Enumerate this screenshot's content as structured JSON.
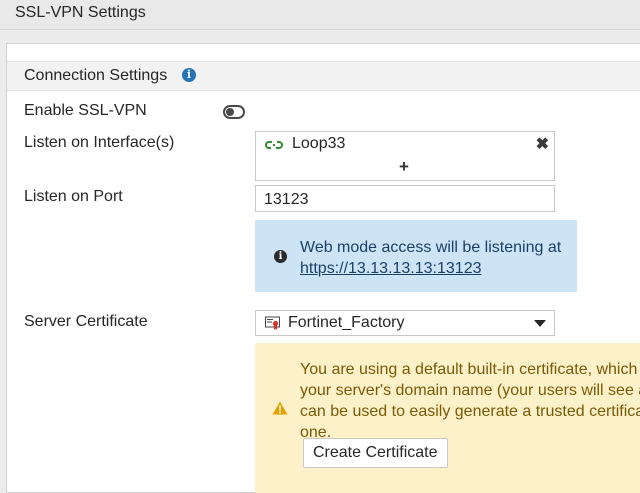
{
  "header": {
    "title": "SSL-VPN Settings"
  },
  "connection_section": {
    "title": "Connection Settings",
    "info_icon": "info-circle-icon"
  },
  "enable_ssl_vpn": {
    "label": "Enable SSL-VPN",
    "enabled": false
  },
  "listen_interfaces": {
    "label": "Listen on Interface(s)",
    "items": [
      {
        "name": "Loop33",
        "icon": "interface-link-icon"
      }
    ],
    "remove_glyph": "✖",
    "add_glyph": "+"
  },
  "listen_port": {
    "label": "Listen on Port",
    "value": "13123"
  },
  "web_mode_info": {
    "text": "Web mode access will be listening at",
    "link": "https://13.13.13.13:13123",
    "icon": "info-icon",
    "color": "#cde4f7"
  },
  "server_certificate": {
    "label": "Server Certificate",
    "selected": "Fortinet_Factory",
    "icon": "certificate-icon"
  },
  "certificate_warning": {
    "lines": [
      "You are using a default built-in certificate, which",
      "your server's domain name (your users will see a",
      "can be used to easily generate a trusted certifica",
      "one."
    ],
    "button_label": "Create Certificate",
    "icon": "warning-icon",
    "color": "#fdf1c9"
  }
}
